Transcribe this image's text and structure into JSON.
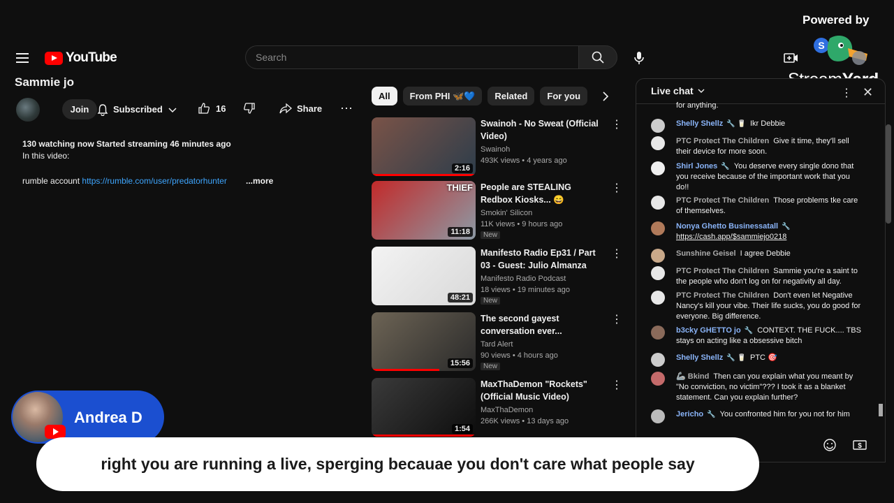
{
  "header": {
    "logo_text": "YouTube",
    "search_placeholder": "Search",
    "icons": [
      "menu-icon",
      "search-icon",
      "mic-icon",
      "create-icon"
    ]
  },
  "overlay": {
    "powered_by": "Powered by",
    "streamyard_a": "Stream",
    "streamyard_b": "Yard",
    "presenter_name": "Andrea D",
    "caption": "right you are running a live, sperging becauae you don't care what people say"
  },
  "video": {
    "channel_title": "Sammie jo",
    "join_label": "Join",
    "subscribed_label": "Subscribed",
    "like_count": "16",
    "share_label": "Share",
    "description": {
      "line1": "130 watching now  Started streaming 46 minutes ago",
      "line2": "In this video:",
      "line3_prefix": "rumble account ",
      "line3_link": "https://rumble.com/user/predatorhunter",
      "more": "...more"
    }
  },
  "chips": [
    "All",
    "From PHI 🦋💙",
    "Related",
    "For you"
  ],
  "recommendations": [
    {
      "title": "Swainoh - No Sweat (Official Video)",
      "channel": "Swainoh",
      "meta": "493K views  •  4 years ago",
      "duration": "2:16",
      "is_new": false,
      "thumb_colors": [
        "#7a5348",
        "#2d3d4a"
      ],
      "progress": 1.0
    },
    {
      "title": "People are STEALING Redbox Kiosks... 😄",
      "channel": "Smokin' Silicon",
      "meta": "11K views  •  9 hours ago",
      "duration": "11:18",
      "is_new": true,
      "new_label": "New",
      "thumb_text": "THIEF",
      "thumb_colors": [
        "#c22a2a",
        "#8c9aa5"
      ],
      "progress": 0
    },
    {
      "title": "Manifesto Radio Ep31 / Part 03 - Guest: Julio Almanza",
      "channel": "Manifesto Radio Podcast",
      "meta": "18 views  •  19 minutes ago",
      "duration": "48:21",
      "is_new": true,
      "new_label": "New",
      "thumb_colors": [
        "#f3f3f3",
        "#d9d9d9"
      ],
      "progress": 0
    },
    {
      "title": "The second gayest conversation ever...",
      "channel": "Tard Alert",
      "meta": "90 views  •  4 hours ago",
      "duration": "15:56",
      "is_new": true,
      "new_label": "New",
      "thumb_colors": [
        "#6d6455",
        "#2a2a2a"
      ],
      "progress": 0.65
    },
    {
      "title": "MaxThaDemon \"Rockets\" (Official Music Video)",
      "channel": "MaxThaDemon",
      "meta": "266K views  •  13 days ago",
      "duration": "1:54",
      "is_new": false,
      "thumb_colors": [
        "#3a3a3a",
        "#0d0d0d"
      ],
      "progress": 1.0
    }
  ],
  "chat": {
    "title": "Live chat",
    "top_cut": "for anything.",
    "messages": [
      {
        "author": "Shelly Shellz",
        "member": true,
        "text": "Ikr Debbie",
        "avatar": "#cccccc",
        "badge": "🔧 🥛"
      },
      {
        "author": "PTC Protect The Children",
        "member": false,
        "text": "Give it time, they'll sell their device for more soon.",
        "avatar": "#e8e8e8"
      },
      {
        "author": "Shirl Jones",
        "member": true,
        "text": "You deserve every single dono that you receive because of the important work that you do!!",
        "avatar": "#f0f0f0",
        "badge": "🔧"
      },
      {
        "author": "PTC Protect The Children",
        "member": false,
        "text": "Those problems tke care of themselves.",
        "avatar": "#e8e8e8"
      },
      {
        "author": "Nonya Ghetto Businessatall",
        "member": true,
        "text": "https://cash.app/$sammiejo0218",
        "link": true,
        "avatar": "#b07a5a",
        "badge": "🔧"
      },
      {
        "author": "Sunshine Geisel",
        "member": false,
        "text": "I agree Debbie",
        "avatar": "#c9a98a"
      },
      {
        "author": "PTC Protect The Children",
        "member": false,
        "text": "Sammie you're a saint to the people who don't log on for negativity all day.",
        "avatar": "#e8e8e8"
      },
      {
        "author": "PTC Protect The Children",
        "member": false,
        "text": "Don't even let Negative Nancy's kill your vibe. Their life sucks, you do good for everyone. Big difference.",
        "avatar": "#e8e8e8"
      },
      {
        "author": "b3cky GHETTO jo",
        "member": true,
        "text": "CONTEXT. THE FUCK.... TBS stays on acting like a obsessive bitch",
        "avatar": "#8a6a5a",
        "badge": "🔧"
      },
      {
        "author": "Shelly Shellz",
        "member": true,
        "text": "PTC",
        "avatar": "#cccccc",
        "badge": "🔧 🥛",
        "emoji": "🎯"
      },
      {
        "author": "Bkind",
        "member": false,
        "text": "Then can you explain what you meant by \"No conviction, no victim\"??? I took it as a blanket statement. Can you explain further?",
        "avatar": "#c46a6a",
        "prefix": "🦾"
      },
      {
        "author": "Jericho",
        "member": true,
        "text": "You confronted him for you not for him",
        "avatar": "#bbbbbb",
        "badge": "🔧"
      }
    ]
  },
  "presenter_tag": {
    "color": "#1b4fd0"
  }
}
